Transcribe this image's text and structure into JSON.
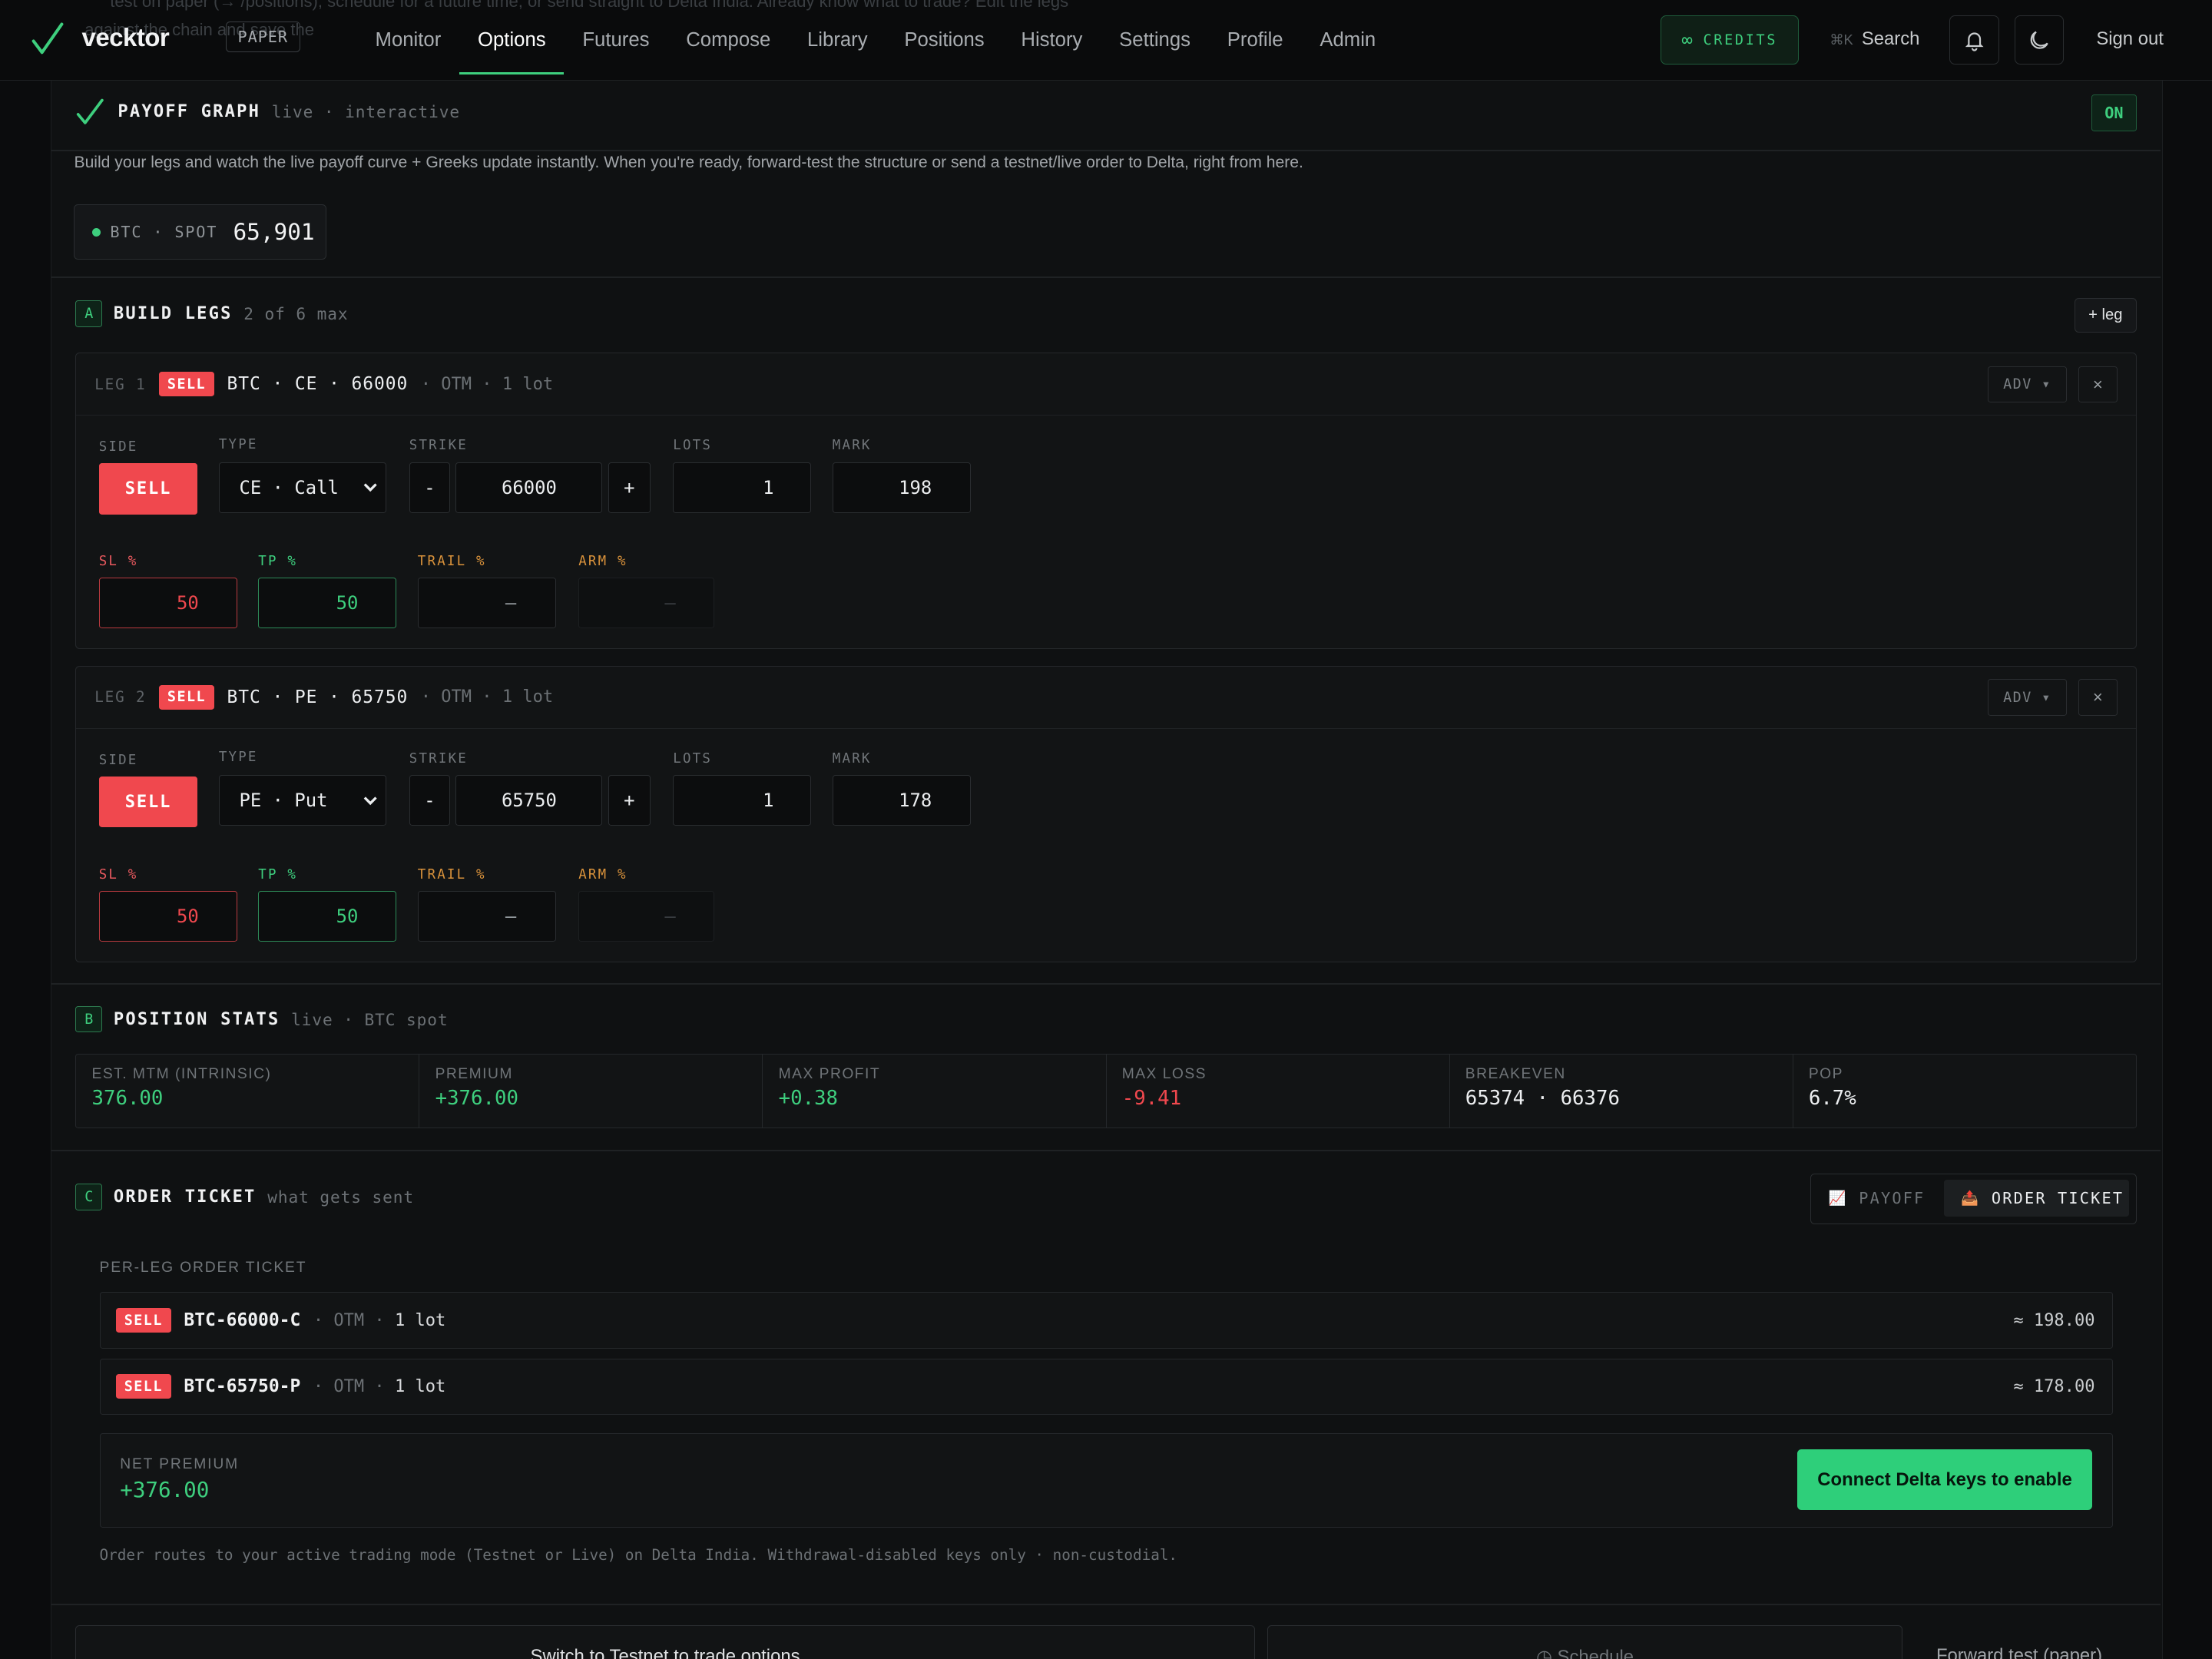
{
  "nav": {
    "brand": "vecktor",
    "mode_badge": "PAPER",
    "items": [
      {
        "label": "Monitor",
        "active": false
      },
      {
        "label": "Options",
        "active": true
      },
      {
        "label": "Futures",
        "active": false
      },
      {
        "label": "Compose",
        "active": false
      },
      {
        "label": "Library",
        "active": false
      },
      {
        "label": "Positions",
        "active": false
      },
      {
        "label": "History",
        "active": false
      },
      {
        "label": "Settings",
        "active": false
      },
      {
        "label": "Profile",
        "active": false
      },
      {
        "label": "Admin",
        "active": false
      }
    ],
    "credits_icon": "∞",
    "credits_label": "CREDITS",
    "search_kbd": "⌘K",
    "search_label": "Search",
    "signout": "Sign out",
    "ghost_line1": "test on paper (→ /positions), schedule for a future time, or send straight to Delta India. Already know what to trade? Edit the legs",
    "ghost_line2": "against the chain and save the"
  },
  "payoff": {
    "title": "PAYOFF GRAPH",
    "subtitle": "live · interactive",
    "status": "ON",
    "description": "Build your legs and watch the live payoff curve + Greeks update instantly. When you're ready, forward-test the structure or send a testnet/live order to Delta, right from here.",
    "spot_label": "BTC · SPOT",
    "spot_value": "65,901"
  },
  "build": {
    "letter": "A",
    "title": "BUILD LEGS",
    "subtitle": "2 of 6 max",
    "add_label": "+ leg",
    "field_labels": {
      "side": "SIDE",
      "type": "TYPE",
      "strike": "STRIKE",
      "lots": "LOTS",
      "mark": "MARK",
      "sl": "SL %",
      "tp": "TP %",
      "trail": "TRAIL %",
      "arm": "ARM %"
    },
    "adv_label": "ADV ▾",
    "close_label": "×",
    "minus": "-",
    "plus": "+",
    "legs": [
      {
        "num": "LEG 1",
        "side": "SELL",
        "symbol": "BTC · CE · 66000",
        "meta": "· OTM · 1 lot",
        "type": "CE · Call",
        "strike": "66000",
        "lots": "1",
        "mark": "198",
        "sl": "50",
        "tp": "50",
        "trail": "—",
        "arm": "—"
      },
      {
        "num": "LEG 2",
        "side": "SELL",
        "symbol": "BTC · PE · 65750",
        "meta": "· OTM · 1 lot",
        "type": "PE · Put",
        "strike": "65750",
        "lots": "1",
        "mark": "178",
        "sl": "50",
        "tp": "50",
        "trail": "—",
        "arm": "—"
      }
    ]
  },
  "stats": {
    "letter": "B",
    "title": "POSITION STATS",
    "subtitle": "live · BTC spot",
    "items": [
      {
        "label": "EST. MTM (INTRINSIC)",
        "value": "376.00"
      },
      {
        "label": "PREMIUM",
        "value": "+376.00"
      },
      {
        "label": "MAX PROFIT",
        "value": "+0.38"
      },
      {
        "label": "MAX LOSS",
        "value": "-9.41"
      },
      {
        "label": "BREAKEVEN",
        "value": "65374 · 66376"
      },
      {
        "label": "POP",
        "value": "6.7%"
      }
    ]
  },
  "order": {
    "letter": "C",
    "title": "ORDER TICKET",
    "subtitle": "what gets sent",
    "tab_payoff_icon": "📈",
    "tab_payoff": "PAYOFF",
    "tab_order_icon": "📤",
    "tab_order": "ORDER TICKET",
    "per_leg_label": "PER-LEG ORDER TICKET",
    "rows": [
      {
        "side": "SELL",
        "symbol": "BTC-66000-C",
        "moneyness": "OTM",
        "lots": "1 lot",
        "amount": "≈ 198.00"
      },
      {
        "side": "SELL",
        "symbol": "BTC-65750-P",
        "moneyness": "OTM",
        "lots": "1 lot",
        "amount": "≈ 178.00"
      }
    ],
    "net_label": "NET PREMIUM",
    "net_value": "+376.00",
    "connect_label": "Connect Delta keys to enable",
    "footnote": "Order routes to your active trading mode (Testnet or Live) on Delta India. Withdrawal-disabled keys only · non-custodial."
  },
  "bottom": {
    "switch_label": "Switch to Testnet to trade options",
    "schedule_label": "◷ Schedule",
    "forward_label": "Forward test (paper)"
  },
  "colors": {
    "accent": "#3ecf7e",
    "danger": "#f0484e",
    "bg": "#0b0c0d"
  }
}
